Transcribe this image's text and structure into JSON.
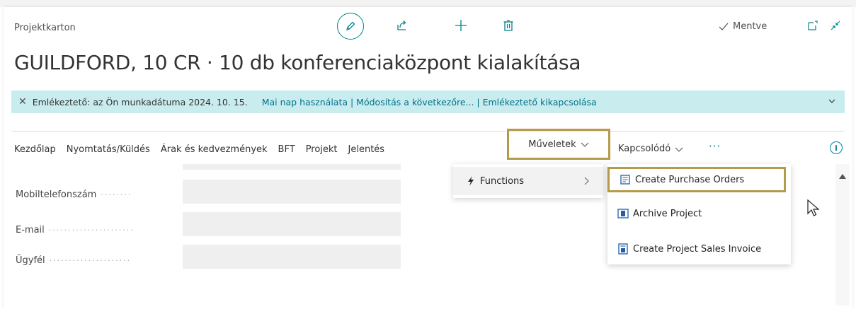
{
  "page": {
    "type_label": "Projektkarton",
    "title": "GUILDFORD, 10 CR · 10 db konferenciaközpont kialakítása",
    "saved_label": "Mentve"
  },
  "notice": {
    "text": "Emlékeztető: az Ön munkadátuma 2024. 10. 15.",
    "actions": "Mai nap használata | Módosítás a következőre... | Emlékeztető kikapcsolása"
  },
  "nav": {
    "items": [
      "Kezdőlap",
      "Nyomtatás/Küldés",
      "Árak és kedvezmények",
      "BFT",
      "Projekt",
      "Jelentés",
      "Műveletek",
      "Kapcsolódó",
      "···"
    ]
  },
  "fields": [
    {
      "label": "Mobiltelefonszám",
      "value": ""
    },
    {
      "label": "E-mail",
      "value": ""
    },
    {
      "label": "Ügyfél",
      "value": ""
    }
  ],
  "menu": {
    "functions_label": "Functions",
    "submenu": [
      "Create Purchase Orders",
      "Archive Project",
      "Create Project Sales Invoice"
    ]
  },
  "colors": {
    "accent": "#008489",
    "highlight_border": "#b59a48",
    "notice_bg": "#c9ecef",
    "link": "#00728a"
  },
  "icons": {
    "edit": "pencil-icon",
    "share": "share-icon",
    "new": "plus-icon",
    "delete": "trash-icon",
    "open_new_window": "open-in-new-icon",
    "collapse": "collapse-icon",
    "info": "info-icon",
    "functions": "lightning-icon"
  }
}
